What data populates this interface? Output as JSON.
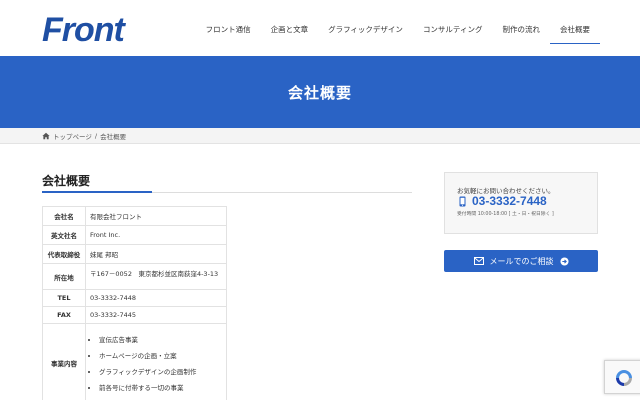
{
  "brand": {
    "logo_text": "Front",
    "color": "#1f4fa3"
  },
  "nav": {
    "items": [
      "フロント通信",
      "企画と文章",
      "グラフィックデザイン",
      "コンサルティング",
      "制作の流れ",
      "会社概要"
    ],
    "active_index": 5
  },
  "hero": {
    "title": "会社概要",
    "bg": "#2a63c5"
  },
  "breadcrumb": {
    "home": "トップページ",
    "separator": "/",
    "current": "会社概要"
  },
  "section": {
    "title": "会社概要"
  },
  "company": {
    "rows": [
      {
        "label": "会社名",
        "value": "有限会社フロント"
      },
      {
        "label": "英文社名",
        "value": "Front Inc."
      },
      {
        "label": "代表取締役",
        "value": "妹尾 邦昭"
      },
      {
        "label": "所在地",
        "value": "〒167－0052　東京都杉並区南荻窪4-3-13"
      },
      {
        "label": "TEL",
        "value": "03-3332-7448"
      },
      {
        "label": "FAX",
        "value": "03-3332-7445"
      }
    ],
    "business_label": "事業内容",
    "business_items": [
      "宣伝広告事業",
      "ホームページの企画・立案",
      "グラフィックデザインの企画制作",
      "前各号に付帯する一切の事業"
    ]
  },
  "contact": {
    "lead": "お気軽にお問い合わせください。",
    "phone": "03-3332-7448",
    "hours": "受付時間 10:00-18:00 [ 土・日・祝日除く ]",
    "mail_label": "メールでのご相談"
  },
  "icons": {
    "home": "home-icon",
    "phone": "mobile-phone-icon",
    "mail": "envelope-icon",
    "arrow": "arrow-circle-right-icon",
    "recaptcha": "recaptcha-icon"
  }
}
